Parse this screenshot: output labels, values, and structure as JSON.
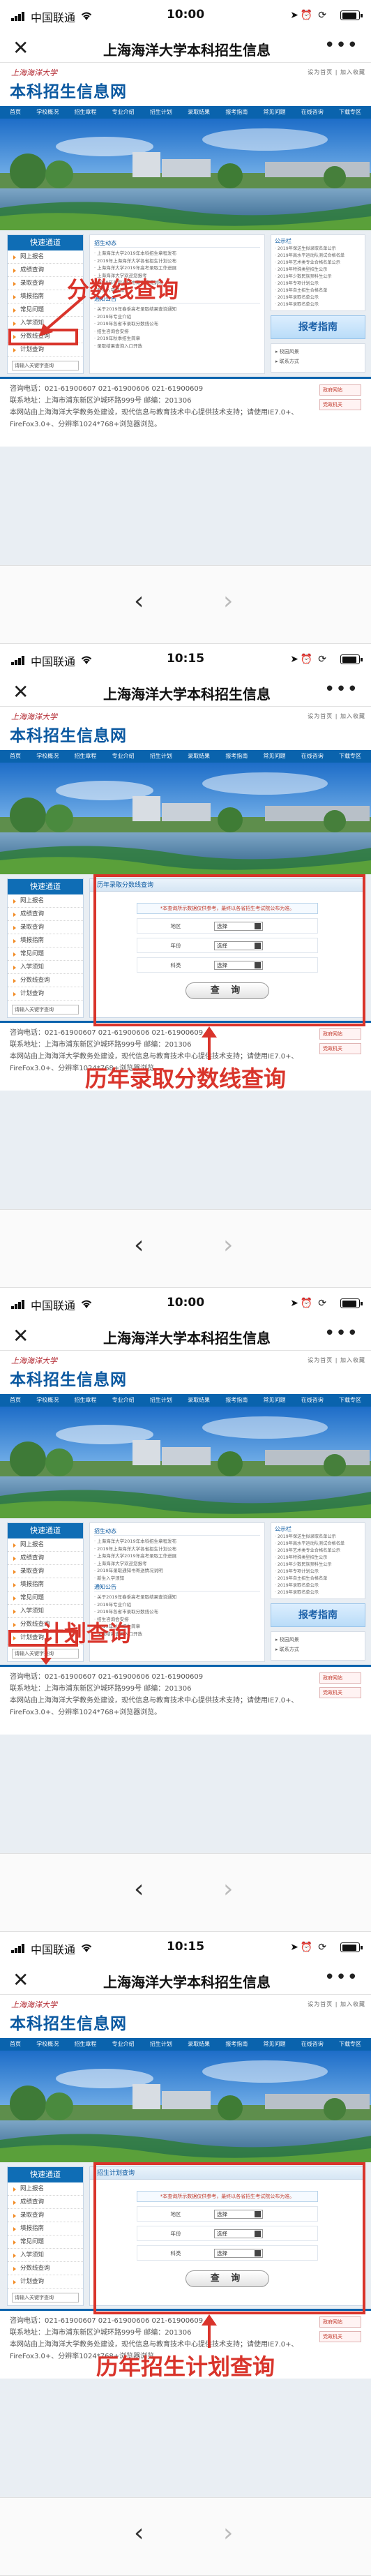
{
  "frames": [
    {
      "status": {
        "carrier": "中国联通",
        "time": "10:00"
      },
      "nav": {
        "title": "上海海洋大学本科招生信息",
        "close": "✕",
        "more": "•••"
      },
      "annotation": "分数线查询",
      "mode": "home",
      "highlight_index": 7
    },
    {
      "status": {
        "carrier": "中国联通",
        "time": "10:15"
      },
      "nav": {
        "title": "上海海洋大学本科招生信息",
        "close": "✕",
        "more": "•••"
      },
      "annotation": "历年录取分数线查询",
      "mode": "form",
      "form_title": "历年录取分数线查询",
      "form_rows": [
        {
          "label": "地区",
          "value": "选择"
        },
        {
          "label": "年份",
          "value": "选择"
        },
        {
          "label": "科类",
          "value": "选择"
        }
      ],
      "button": "查 询"
    },
    {
      "status": {
        "carrier": "中国联通",
        "time": "10:00"
      },
      "nav": {
        "title": "上海海洋大学本科招生信息",
        "close": "✕",
        "more": "•••"
      },
      "annotation": "计划查询",
      "mode": "home",
      "highlight_index": 8
    },
    {
      "status": {
        "carrier": "中国联通",
        "time": "10:15"
      },
      "nav": {
        "title": "上海海洋大学本科招生信息",
        "close": "✕",
        "more": "•••"
      },
      "annotation": "历年招生计划查询",
      "mode": "form",
      "form_title": "招生计划查询",
      "form_rows": [
        {
          "label": "地区",
          "value": "选择"
        },
        {
          "label": "年份",
          "value": "选择"
        },
        {
          "label": "科类",
          "value": "选择"
        }
      ],
      "button": "查 询"
    }
  ],
  "site": {
    "logo_top": "上海海洋大学",
    "logo_main": "本科招生信息网",
    "header_links": "设为首页 | 加入收藏",
    "menu": [
      "首页",
      "学校概况",
      "招生章程",
      "专业介绍",
      "招生计划",
      "录取结果",
      "报考指南",
      "常见问题",
      "在线咨询",
      "下载专区"
    ],
    "quick_title": "快速通道",
    "quick_items": [
      "网上报名",
      "成绩查询",
      "录取查询",
      "填报指南",
      "常见问题",
      "入学须知",
      "分数线查询",
      "计划查询"
    ],
    "search_placeholder": "请输入关键字查询",
    "news_title": "招生动态",
    "news_items": [
      "上海海洋大学2019年本科招生章程发布",
      "2019年上海海洋大学各省招生计划公布",
      "上海海洋大学2019年高考录取工作进展",
      "上海海洋大学欢迎您报考",
      "2019年录取通知书寄送情况说明",
      "新生入学须知"
    ],
    "notice_title": "通知公告",
    "notice_items": [
      "关于2019年春季高考录取结果查询通知",
      "2019年专业介绍",
      "2019年各省市录取分数线公布",
      "招生咨询会安排",
      "2019年秋季招生简章",
      "录取结果查询入口开放"
    ],
    "right_title": "公示栏",
    "right_items": [
      "2019年保送生拟录取名单公示",
      "2019年高水平运动队测试合格名单",
      "2019年艺术类专业合格名单公示",
      "2019年特殊类型招生公示",
      "2019年少数民族预科生公示",
      "2019年专项计划公示",
      "2019年自主招生合格名单",
      "2019年录取名单公示",
      "2019年录取名单公示"
    ],
    "guide": "报考指南",
    "extra_links": [
      "校园风景",
      "联系方式"
    ],
    "footer_lines": [
      "咨询电话：021-61900607    021-61900606    021-61900609",
      "联系地址：上海市浦东新区沪城环路999号        邮编：201306",
      "本网站由上海海洋大学教务处建设，现代信息与教育技术中心提供技术支持；请使用IE7.0+、",
      "FireFox3.0+、分辨率1024*768+浏览器浏览。"
    ],
    "footer_icons": [
      "政府网站",
      "党政机关"
    ],
    "form_note": "*本查询所示数据仅供参考，最终以各省招生考试院公布为准。"
  },
  "colors": {
    "accent": "#0a63ad",
    "annotation": "#d9342b"
  }
}
